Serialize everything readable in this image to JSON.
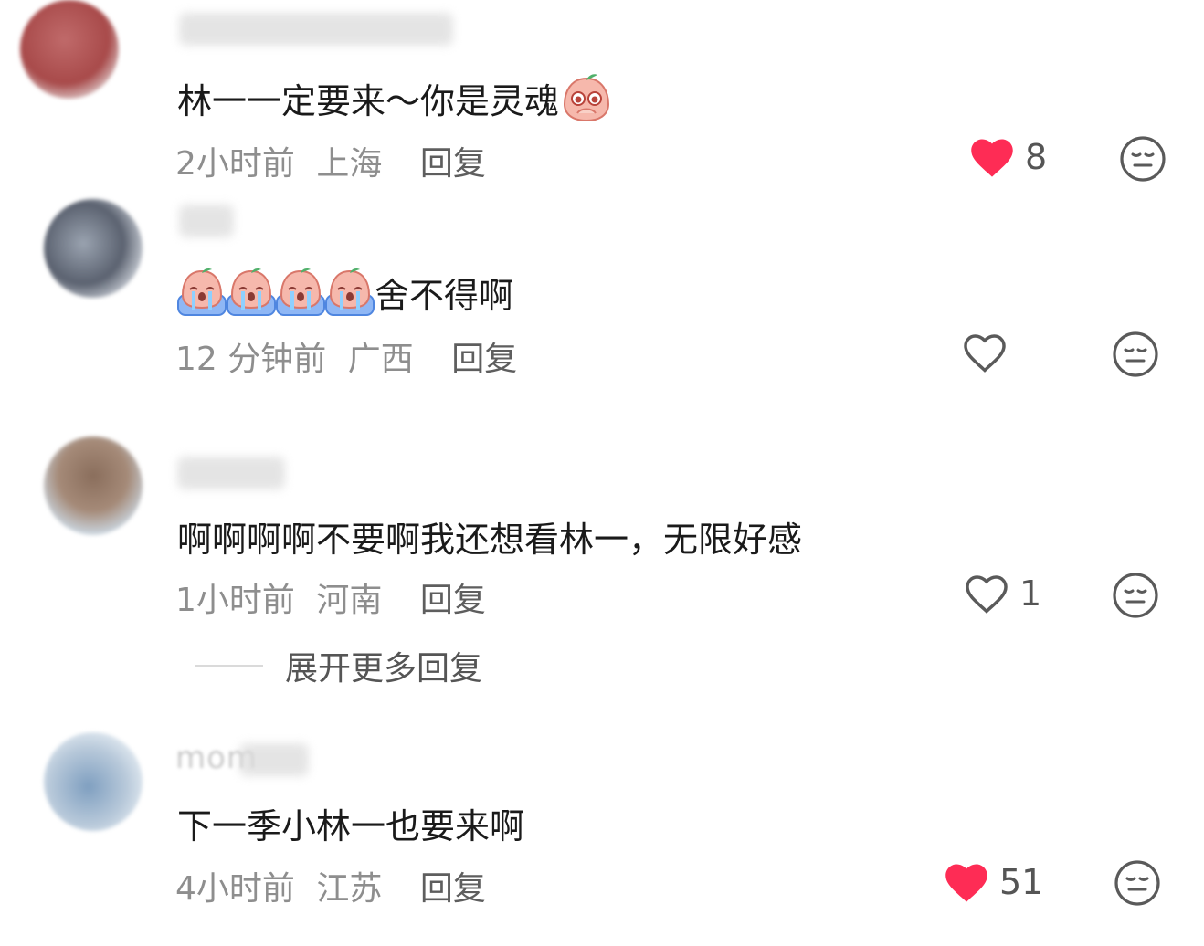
{
  "comments": [
    {
      "username": "",
      "text": "林一一定要来～你是灵魂",
      "time": "2小时前",
      "location": "上海",
      "reply_label": "回复",
      "liked": true,
      "like_count": "8"
    },
    {
      "username": "",
      "text": "舍不得啊",
      "time": "12 分钟前",
      "location": "广西",
      "reply_label": "回复",
      "liked": false,
      "like_count": ""
    },
    {
      "username": "",
      "text": "啊啊啊啊不要啊我还想看林一，无限好感",
      "time": "1小时前",
      "location": "河南",
      "reply_label": "回复",
      "liked": false,
      "like_count": "1"
    },
    {
      "username": "mom",
      "text": "下一季小林一也要来啊",
      "time": "4小时前",
      "location": "江苏",
      "reply_label": "回复",
      "liked": true,
      "like_count": "51"
    }
  ],
  "expand_replies_label": "展开更多回复",
  "icons": {
    "like_filled": "heart-filled-icon",
    "like_outline": "heart-outline-icon",
    "react": "meh-face-icon",
    "sticker_plead": "pleading-peach-sticker",
    "sticker_cry": "crying-peach-sticker"
  },
  "colors": {
    "like_red": "#fe2c55",
    "meta_gray": "#8e8e8e",
    "text": "#1a1a1a"
  }
}
